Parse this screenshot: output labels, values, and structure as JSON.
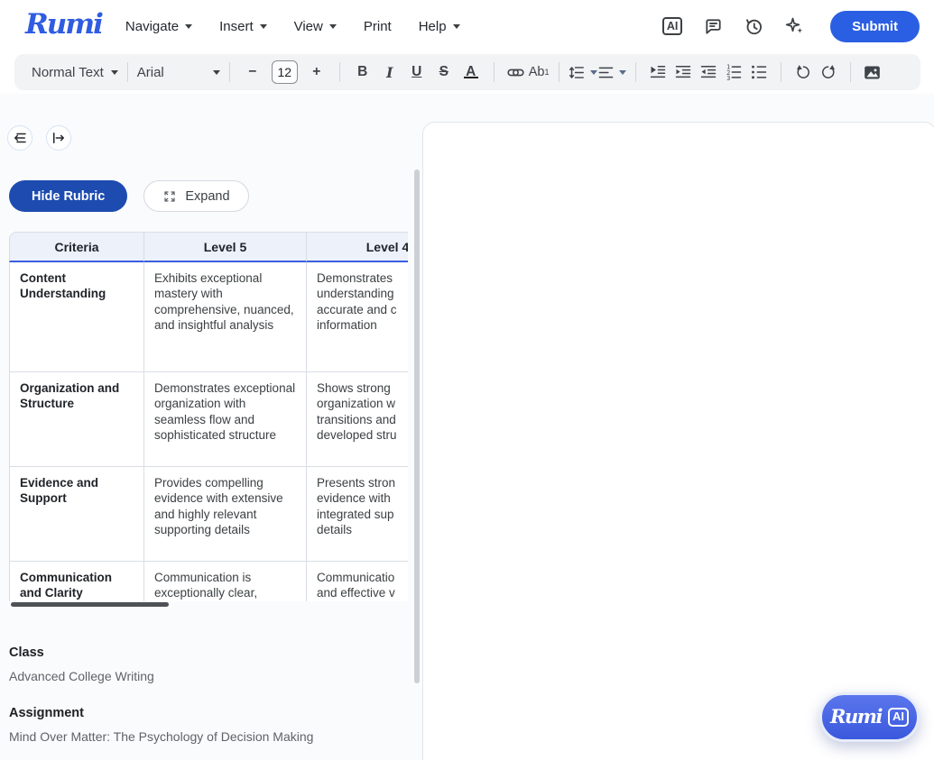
{
  "header": {
    "logo_text": "Rumi",
    "menus": [
      {
        "label": "Navigate",
        "caret": true
      },
      {
        "label": "Insert",
        "caret": true
      },
      {
        "label": "View",
        "caret": true
      },
      {
        "label": "Print",
        "caret": false
      },
      {
        "label": "Help",
        "caret": true
      }
    ],
    "ai_icon_label": "AI",
    "submit_label": "Submit"
  },
  "toolbar": {
    "style_selector": "Normal Text",
    "font_selector": "Arial",
    "font_size": "12",
    "decrease_label": "−",
    "increase_label": "+",
    "bold_label": "B",
    "italic_label": "I",
    "underline_label": "U",
    "strikethrough_label": "S",
    "text_color_label": "A",
    "superscript_label": "Ab",
    "superscript_sup": "1"
  },
  "rubric_panel": {
    "hide_rubric_label": "Hide Rubric",
    "expand_label": "Expand",
    "table": {
      "headers": [
        "Criteria",
        "Level 5",
        "Level 4"
      ],
      "rows": [
        {
          "criteria": "Content Understanding",
          "level5": "Exhibits exceptional mastery with comprehensive, nuanced, and insightful analysis",
          "level4_visible": "Demonstrates\nunderstanding\naccurate and c\ninformation"
        },
        {
          "criteria": "Organization and Structure",
          "level5": "Demonstrates exceptional organization with seamless flow and sophisticated structure",
          "level4_visible": "Shows strong\norganization w\ntransitions and\ndeveloped stru"
        },
        {
          "criteria": "Evidence and Support",
          "level5": "Provides compelling evidence with extensive and highly relevant supporting details",
          "level4_visible": "Presents stron\nevidence with\nintegrated sup\ndetails"
        },
        {
          "criteria": "Communication and Clarity",
          "level5": "Communication is exceptionally clear,",
          "level4_visible": "Communicatio\nand effective v"
        }
      ]
    },
    "class_label": "Class",
    "class_value": "Advanced College Writing",
    "assignment_label": "Assignment",
    "assignment_value": "Mind Over Matter: The Psychology of Decision Making"
  },
  "floating_button": {
    "brand": "Rumi",
    "badge": "AI"
  },
  "colors": {
    "accent_blue": "#2b5fe3",
    "dark_blue": "#1d4bb0",
    "logo_blue": "#2f5ce0",
    "table_header_bg": "#edf1fa",
    "table_header_border": "#3a5fe0",
    "toolbar_bg": "#f1f3f4",
    "panel_bg": "#fafbfc"
  }
}
